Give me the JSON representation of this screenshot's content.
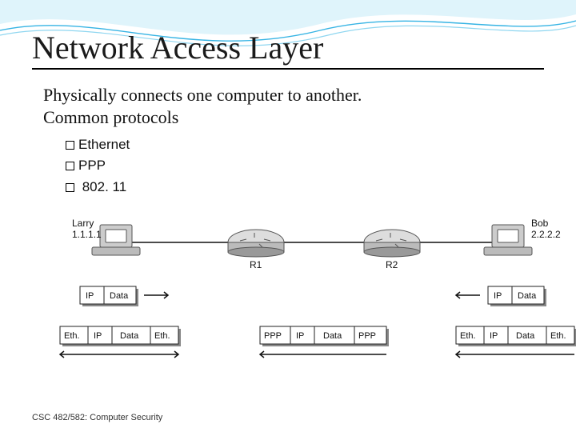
{
  "title": "Network Access Layer",
  "intro_line1": "Physically connects one computer to another.",
  "intro_line2": "Common protocols",
  "protocols": {
    "p0": "Ethernet",
    "p1": "PPP",
    "p2": " 802. 11"
  },
  "diagram": {
    "host_left": {
      "name": "Larry",
      "ip": "1.1.1.1"
    },
    "host_right": {
      "name": "Bob",
      "ip": "2.2.2.2"
    },
    "router1": "R1",
    "router2": "R2",
    "cell_ip": "IP",
    "cell_data": "Data",
    "cell_eth": "Eth.",
    "cell_ppp": "PPP"
  },
  "footer": "CSC 482/582: Computer Security"
}
